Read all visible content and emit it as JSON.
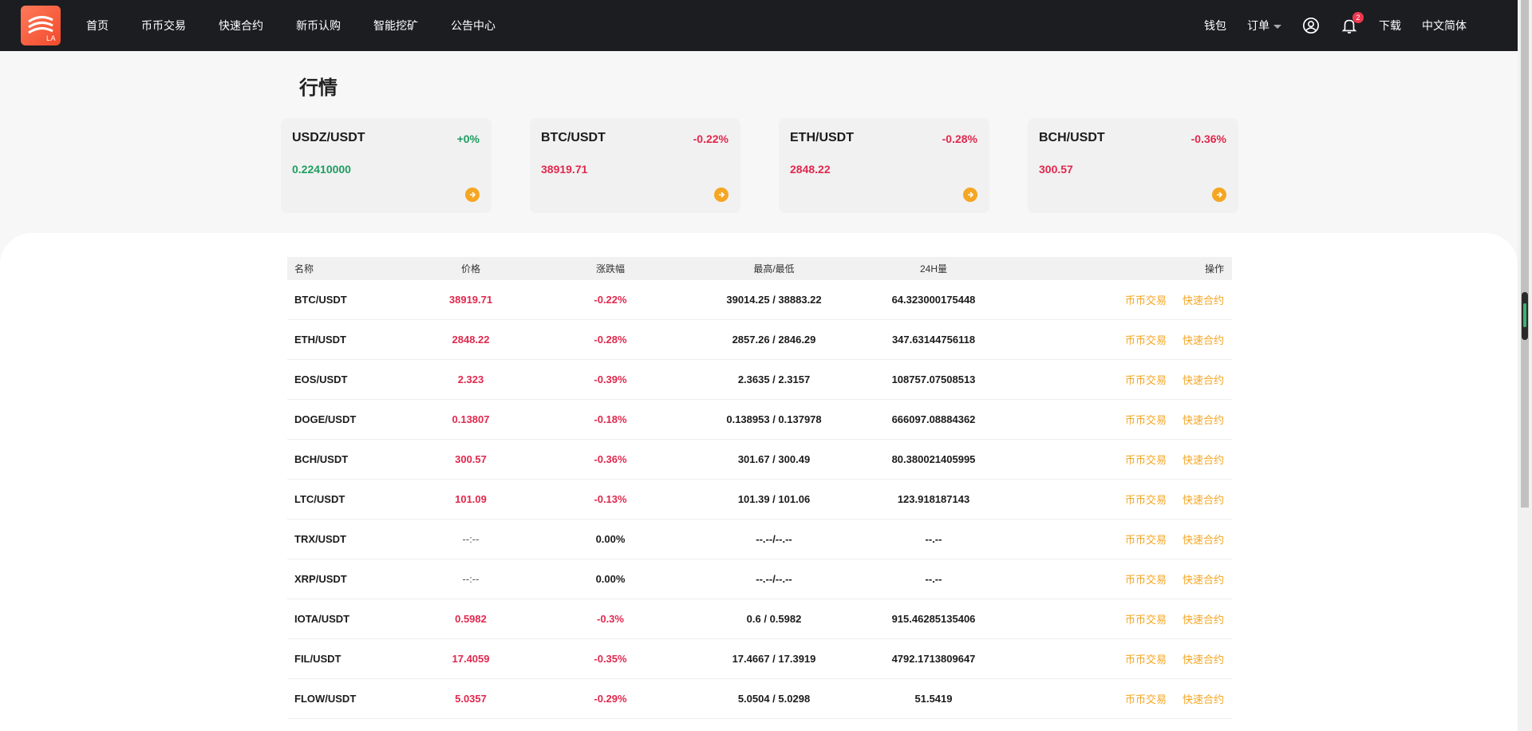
{
  "nav": {
    "logo_text": "LA",
    "items": [
      "首页",
      "币币交易",
      "快速合约",
      "新币认购",
      "智能挖矿",
      "公告中心"
    ],
    "wallet": "钱包",
    "orders": "订单",
    "notification_count": "2",
    "download": "下载",
    "language": "中文简体"
  },
  "page": {
    "title": "行情"
  },
  "cards": [
    {
      "pair": "USDZ/USDT",
      "change": "+0%",
      "price": "0.22410000",
      "trend": "up"
    },
    {
      "pair": "BTC/USDT",
      "change": "-0.22%",
      "price": "38919.71",
      "trend": "down"
    },
    {
      "pair": "ETH/USDT",
      "change": "-0.28%",
      "price": "2848.22",
      "trend": "down"
    },
    {
      "pair": "BCH/USDT",
      "change": "-0.36%",
      "price": "300.57",
      "trend": "down"
    }
  ],
  "table": {
    "headers": {
      "name": "名称",
      "price": "价格",
      "change": "涨跌幅",
      "high_low": "最高/最低",
      "volume": "24H量",
      "action": "操作"
    },
    "action_spot": "币币交易",
    "action_contract": "快速合约",
    "rows": [
      {
        "name": "BTC/USDT",
        "price": "38919.71",
        "change": "-0.22%",
        "high_low": "39014.25 / 38883.22",
        "volume": "64.323000175448",
        "trend": "down"
      },
      {
        "name": "ETH/USDT",
        "price": "2848.22",
        "change": "-0.28%",
        "high_low": "2857.26 / 2846.29",
        "volume": "347.63144756118",
        "trend": "down"
      },
      {
        "name": "EOS/USDT",
        "price": "2.323",
        "change": "-0.39%",
        "high_low": "2.3635 / 2.3157",
        "volume": "108757.07508513",
        "trend": "down"
      },
      {
        "name": "DOGE/USDT",
        "price": "0.13807",
        "change": "-0.18%",
        "high_low": "0.138953 / 0.137978",
        "volume": "666097.08884362",
        "trend": "down"
      },
      {
        "name": "BCH/USDT",
        "price": "300.57",
        "change": "-0.36%",
        "high_low": "301.67 / 300.49",
        "volume": "80.380021405995",
        "trend": "down"
      },
      {
        "name": "LTC/USDT",
        "price": "101.09",
        "change": "-0.13%",
        "high_low": "101.39 / 101.06",
        "volume": "123.918187143",
        "trend": "down"
      },
      {
        "name": "TRX/USDT",
        "price": "--:--",
        "change": "0.00%",
        "high_low": "--.--/--.--",
        "volume": "--.--",
        "trend": "none"
      },
      {
        "name": "XRP/USDT",
        "price": "--:--",
        "change": "0.00%",
        "high_low": "--.--/--.--",
        "volume": "--.--",
        "trend": "none"
      },
      {
        "name": "IOTA/USDT",
        "price": "0.5982",
        "change": "-0.3%",
        "high_low": "0.6 / 0.5982",
        "volume": "915.46285135406",
        "trend": "down"
      },
      {
        "name": "FIL/USDT",
        "price": "17.4059",
        "change": "-0.35%",
        "high_low": "17.4667 / 17.3919",
        "volume": "4792.1713809647",
        "trend": "down"
      },
      {
        "name": "FLOW/USDT",
        "price": "5.0357",
        "change": "-0.29%",
        "high_low": "5.0504 / 5.0298",
        "volume": "51.5419",
        "trend": "down"
      }
    ]
  },
  "colors": {
    "up": "#1f9d62",
    "down": "#e0284d",
    "accent": "#f5a623",
    "nav_bg": "#1b1d21"
  }
}
